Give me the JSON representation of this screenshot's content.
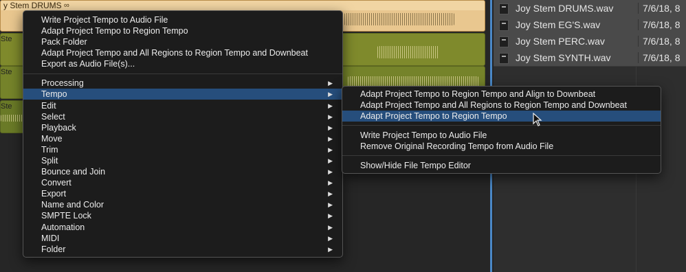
{
  "tracks": {
    "drums_region_title": "y Stem DRUMS",
    "drums_loop_icon": "loop-icon",
    "left_labels": [
      "Ste",
      "Ste",
      "Ste"
    ]
  },
  "browser": {
    "files": [
      {
        "name": "Joy Stem DRUMS.wav",
        "date": "7/6/18, 8"
      },
      {
        "name": "Joy Stem EG'S.wav",
        "date": "7/6/18, 8"
      },
      {
        "name": "Joy Stem PERC.wav",
        "date": "7/6/18, 8"
      },
      {
        "name": "Joy Stem SYNTH.wav",
        "date": "7/6/18, 8"
      }
    ]
  },
  "menu": {
    "top_items": [
      "Write Project Tempo to Audio File",
      "Adapt Project Tempo to Region Tempo",
      "Pack Folder",
      "Adapt Project Tempo and All Regions to Region Tempo and Downbeat",
      "Export as Audio File(s)..."
    ],
    "submenus": [
      "Processing",
      "Tempo",
      "Edit",
      "Select",
      "Playback",
      "Move",
      "Trim",
      "Split",
      "Bounce and Join",
      "Convert",
      "Export",
      "Name and Color",
      "SMPTE Lock",
      "Automation",
      "MIDI",
      "Folder"
    ],
    "highlighted": "Tempo"
  },
  "tempo_submenu": {
    "group1": [
      "Adapt Project Tempo to Region Tempo and Align to Downbeat",
      "Adapt Project Tempo and All Regions to Region Tempo and Downbeat",
      "Adapt Project Tempo to Region Tempo"
    ],
    "group2": [
      "Write Project Tempo to Audio File",
      "Remove Original Recording Tempo from Audio File"
    ],
    "group3": [
      "Show/Hide File Tempo Editor"
    ],
    "highlighted": "Adapt Project Tempo to Region Tempo"
  },
  "colors": {
    "highlight": "#264e7c",
    "drums_region": "#e9c78f",
    "audio_region": "#7f8a2c",
    "divider": "#4a88c7"
  }
}
